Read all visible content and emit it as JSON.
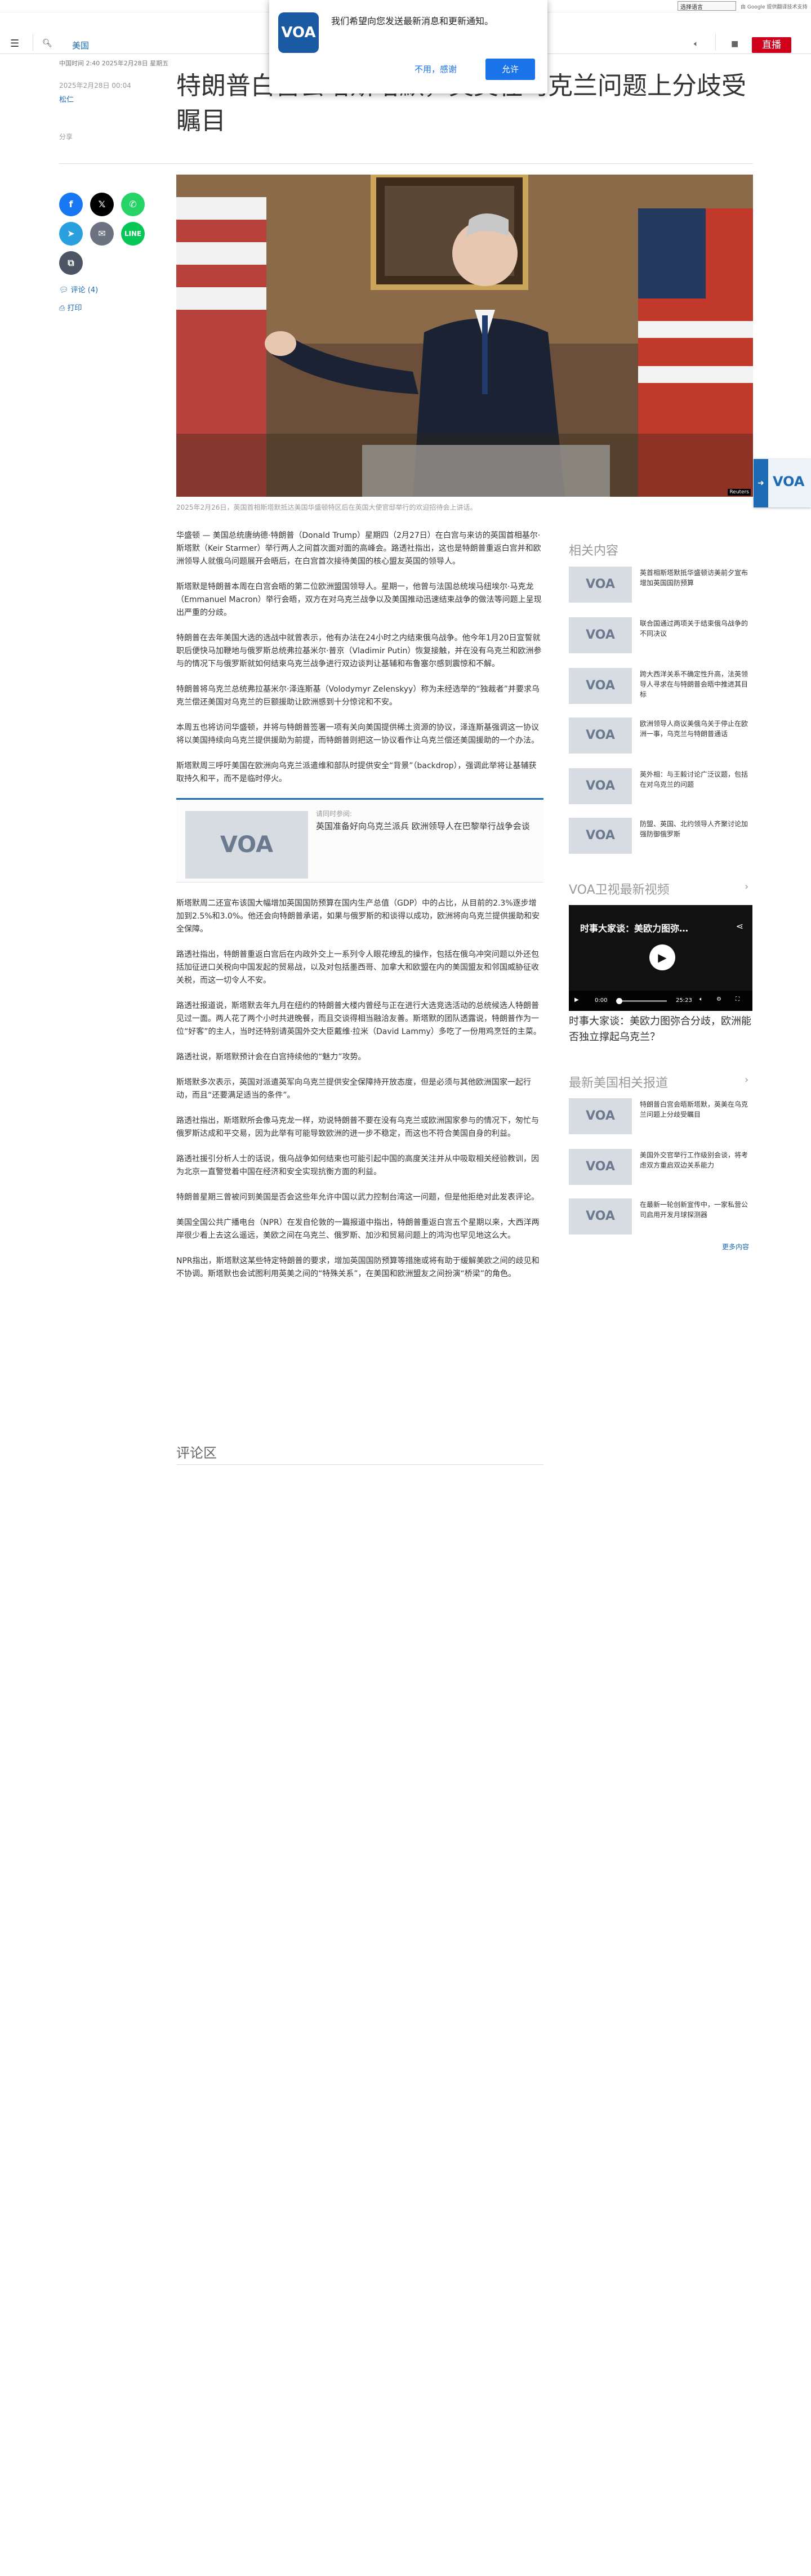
{
  "topbar": {
    "language_select": "选择语言",
    "translate": "由 Google 提供翻译技术支持"
  },
  "nav": {
    "menu_icon": "menu-icon",
    "search_icon": "search-icon",
    "section": "美国",
    "live_label": "直播"
  },
  "notification": {
    "message": "我们希望向您发送最新消息和更新通知。",
    "logo": "VOA",
    "decline": "不用，感谢",
    "accept": "允许"
  },
  "article": {
    "dateline": "中国时间 2:40 2025年2月28日 星期五",
    "pubdate": "2025年2月28日 00:04",
    "author": "松仁",
    "title": "特朗普白宫会晤斯塔默，英美在乌克兰问题上分歧受瞩目",
    "share_label": "分享",
    "comments_link": "评论 (4)",
    "print_link": "打印",
    "caption": "2025年2月26日，英国首相斯塔默抵达美国华盛顿特区后在英国大使官邸举行的欢迎招待会上讲话。",
    "photo_credit": "Reuters",
    "paragraphs": [
      "华盛顿 — 美国总统唐纳德·特朗普（Donald Trump）星期四（2月27日）在白宫与来访的英国首相基尔·斯塔默（Keir Starmer）举行两人之间首次面对面的高峰会。路透社指出，这也是特朗普重返白宫并和欧洲领导人就俄乌问题展开会晤后，在白宫首次接待美国的核心盟友英国的领导人。",
      "斯塔默是特朗普本周在白宫会晤的第二位欧洲盟国领导人。星期一，他曾与法国总统埃马纽埃尔·马克龙（Emmanuel Macron）举行会晤，双方在对乌克兰战争以及美国推动迅速结束战争的做法等问题上呈现出严重的分歧。",
      "特朗普在去年美国大选的选战中就曾表示，他有办法在24小时之内结束俄乌战争。他今年1月20日宣誓就职后便快马加鞭地与俄罗斯总统弗拉基米尔·普京（Vladimir Putin）恢复接触，并在没有乌克兰和欧洲参与的情况下与俄罗斯就如何结束乌克兰战争进行双边谈判让基辅和布鲁塞尔感到震惊和不解。",
      "特朗普将乌克兰总统弗拉基米尔·泽连斯基（Volodymyr Zelenskyy）称为未经选举的“独裁者”并要求乌克兰偿还美国对乌克兰的巨额援助让欧洲感到十分惊诧和不安。",
      "本周五也将访问华盛顿，并将与特朗普签署一项有关向美国提供稀土资源的协议，泽连斯基强调这一协议将以美国持续向乌克兰提供援助为前提，而特朗普则把这一协议看作让乌克兰偿还美国援助的一个办法。",
      "斯塔默周三呼吁美国在欧洲向乌克兰派遣维和部队时提供安全“背景”（backdrop），强调此举将让基辅获取持久和平，而不是临时停火。",
      "斯塔默周二还宣布该国大幅增加英国国防预算在国内生产总值（GDP）中的占比，从目前的2.3%逐步增加到2.5%和3.0%。他还会向特朗普承诺，如果与俄罗斯的和谈得以成功，欧洲将向乌克兰提供援助和安全保障。",
      "路透社指出，特朗普重返白宫后在内政外交上一系列令人眼花缭乱的操作，包括在俄乌冲突问题以外还包括加征进口关税向中国发起的贸易战，以及对包括墨西哥、加拿大和欧盟在内的美国盟友和邻国威胁征收关税，而这一切令人不安。",
      "路透社报道说，斯塔默去年九月在纽约的特朗普大楼内曾经与正在进行大选竞选活动的总统候选人特朗普见过一面。两人花了两个小时共进晚餐，而且交谈得相当融洽友善。斯塔默的团队透露说，特朗普作为一位“好客”的主人，当时还特别请英国外交大臣戴维·拉米（David Lammy）多吃了一份用鸡烹饪的主菜。",
      "路透社说，斯塔默预计会在白宫持续他的“魅力”攻势。",
      "斯塔默多次表示，英国对派遣英军向乌克兰提供安全保障持开放态度，但是必须与其他欧洲国家一起行动，而且“还要满足适当的条件”。",
      "路透社指出，斯塔默所会像马克龙一样，劝说特朗普不要在没有乌克兰或欧洲国家参与的情况下，匆忙与俄罗斯达成和平交易，因为此举有可能导致欧洲的进一步不稳定，而这也不符合美国自身的利益。",
      "路透社援引分析人士的话说，俄乌战争如何结束也可能引起中国的高度关注并从中吸取相关经验教训，因为北京一直警觉着中国在经济和安全实现抗衡方面的利益。",
      "特朗普星期三曾被问到美国是否会这些年允许中国以武力控制台湾这一问题，但是他拒绝对此发表评论。",
      "美国全国公共广播电台（NPR）在发自伦敦的一篇报道中指出，特朗普重返白宫五个星期以来，大西洋两岸很少看上去这么遥远，美欧之间在乌克兰、俄罗斯、加沙和贸易问题上的鸿沟也罕见地这么大。",
      "NPR指出，斯塔默这某些特定特朗普的要求，增加英国国防预算等措施或将有助于缓解美欧之间的歧见和不协调。斯塔默也会试图利用英美之间的“特殊关系”，在美国和欧洲盟友之间扮演“桥梁”的角色。"
    ],
    "related_inline": {
      "label": "请同时参阅:",
      "headline": "英国准备好向乌克兰派兵 欧洲领导人在巴黎举行战争会谈",
      "thumb": "VOA"
    },
    "comments_heading": "评论区"
  },
  "sidebar": {
    "related_heading": "相关内容",
    "related": [
      "英首相斯塔默抵华盛顿访美前夕宣布增加英国国防预算",
      "联合国通过两项关于结束俄乌战争的不同决议",
      "跨大西洋关系不确定性升高，法英领导人寻求在与特朗普会晤中推进其目标",
      "欧洲领导人商议美俄乌关于停止在欧洲一事，乌克兰与特朗普通话",
      "英外相：与王毅讨论广泛议题，包括在对乌克兰的问题",
      "防盟、英国、北约领导人齐聚讨论加强防御俄罗斯"
    ],
    "video_heading": "VOA卫视最新视频",
    "video": {
      "title_overlay": "时事大家谈：美欧力图弥…",
      "time_current": "0:00",
      "time_total": "25:23",
      "title": "时事大家谈：美欧力图弥合分歧，欧洲能否独立撑起乌克兰？"
    },
    "latest_heading": "最新美国相关报道",
    "latest": [
      "特朗普白宫会晤斯塔默，英美在乌克兰问题上分歧受瞩目",
      "美国外交官举行工作级别会谈，将考虑双方重启双边关系能力",
      "在最新一轮创新宣传中，一家私营公司启用开发月球探测器"
    ],
    "more_label": "更多内容"
  },
  "colors": {
    "accent": "#1c6bb4",
    "live": "#d0021b",
    "facebook": "#1877f2",
    "x": "#000000",
    "whatsapp": "#25d366",
    "telegram": "#2aa1de",
    "email": "#6b7280",
    "line": "#06c755"
  }
}
